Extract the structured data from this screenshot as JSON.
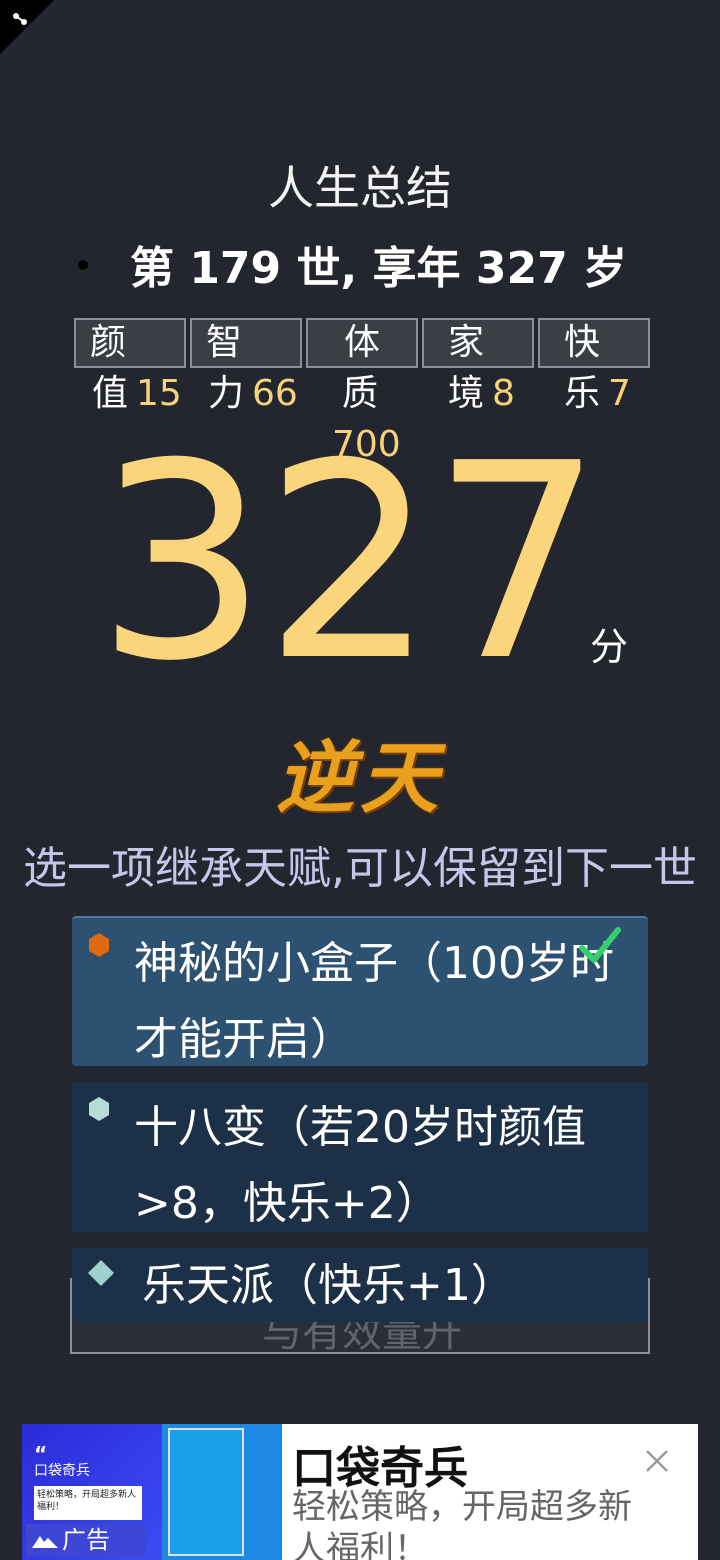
{
  "page": {
    "title": "人生总结",
    "summary": "第 179 世, 享年 327 岁"
  },
  "stats": [
    {
      "box": "颜",
      "label": "值",
      "value": "15"
    },
    {
      "box": "智",
      "label": "力",
      "value": "66"
    },
    {
      "box": "体",
      "label": "质",
      "value": ""
    },
    {
      "box": "家",
      "label": "境",
      "value": "8"
    },
    {
      "box": "快",
      "label": "乐",
      "value": "7"
    }
  ],
  "body_value": "700",
  "score": {
    "value": "327",
    "unit": "分",
    "grade": "逆天"
  },
  "inherit": {
    "prompt": "选一项继承天赋,可以保留到下一世",
    "talents": [
      {
        "text": "神秘的小盒子（100岁时才能开启）",
        "color": "#e06a10",
        "selected": true
      },
      {
        "text": "十八变（若20岁时颜值>8，快乐+2）",
        "color": "#b6dcd8",
        "selected": false
      },
      {
        "text": "乐天派（快乐+1）",
        "color": "#9fd0cc",
        "selected": false
      }
    ],
    "hidden_button_text": "与有效量升"
  },
  "ad": {
    "quote_mark": "“",
    "brand_small": "口袋奇兵",
    "card_text": "轻松策略，开局超多新人福利！",
    "tag": "广告",
    "title": "口袋奇兵",
    "description": "轻松策略，开局超多新人福利！"
  }
}
